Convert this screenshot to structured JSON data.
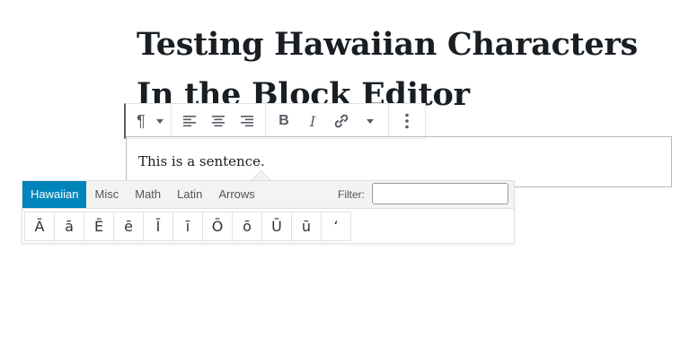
{
  "post": {
    "title_line1": "Testing Hawaiian Characters",
    "title_line2": "In the Block Editor"
  },
  "toolbar": {
    "buttons": [
      {
        "name": "paragraph-icon",
        "glyph": "¶"
      },
      {
        "name": "align-left-icon"
      },
      {
        "name": "align-center-icon"
      },
      {
        "name": "align-right-icon"
      },
      {
        "name": "bold-icon",
        "glyph": "B"
      },
      {
        "name": "italic-icon",
        "glyph": "I"
      },
      {
        "name": "link-icon"
      },
      {
        "name": "more-formatting-chevron-icon"
      },
      {
        "name": "more-options-icon"
      }
    ]
  },
  "block": {
    "text": "This is a sentence."
  },
  "charmap": {
    "tabs": [
      "Hawaiian",
      "Misc",
      "Math",
      "Latin",
      "Arrows"
    ],
    "active_tab": "Hawaiian",
    "active_color": "#0085ba",
    "filter_label": "Filter:",
    "filter_value": "",
    "characters": [
      "Ā",
      "ā",
      "Ē",
      "ē",
      "Ī",
      "ī",
      "Ō",
      "ō",
      "Ū",
      "ū",
      "ʻ"
    ]
  }
}
